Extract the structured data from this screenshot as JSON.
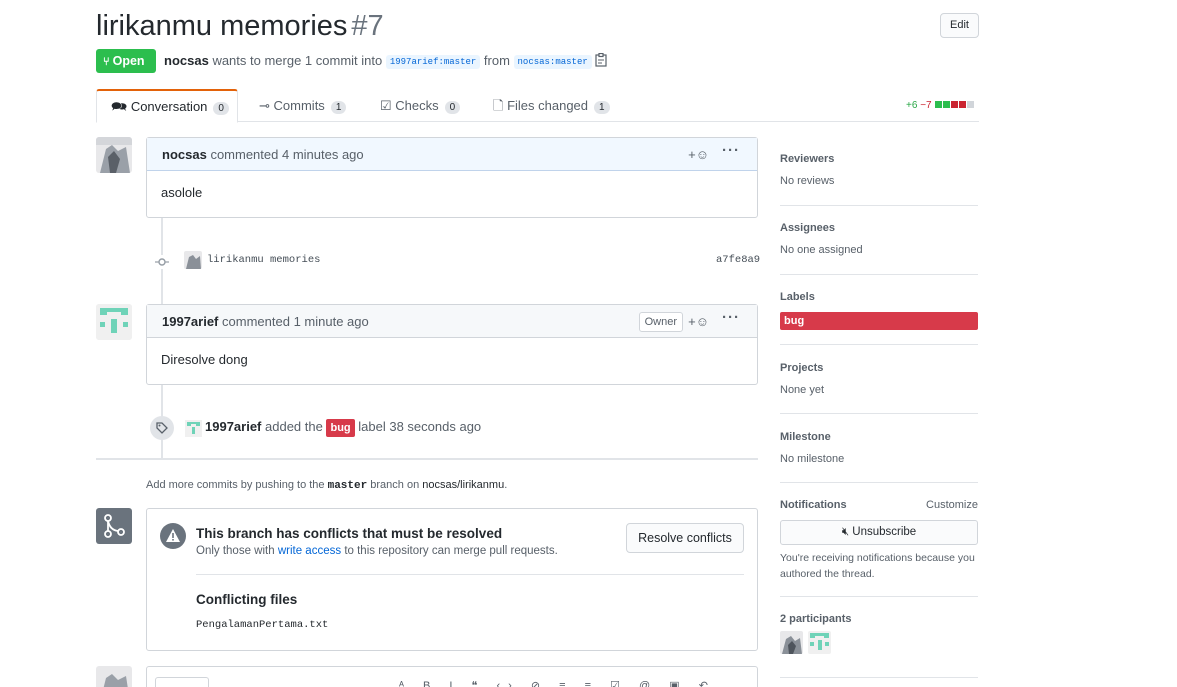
{
  "header": {
    "title": "lirikanmu memories",
    "number": "#7",
    "edit_label": "Edit",
    "state": "Open",
    "author": "nocsas",
    "merge_text": "wants to merge 1 commit into",
    "base_branch": "1997arief:master",
    "from_text": "from",
    "head_branch": "nocsas:master"
  },
  "tabs": [
    {
      "label": "Conversation",
      "count": "0"
    },
    {
      "label": "Commits",
      "count": "1"
    },
    {
      "label": "Checks",
      "count": "0"
    },
    {
      "label": "Files changed",
      "count": "1"
    }
  ],
  "diffstat": {
    "additions": "+6",
    "deletions": "−7"
  },
  "timeline": {
    "comment1": {
      "author": "nocsas",
      "action": "commented",
      "time": "4 minutes ago",
      "body": "asolole"
    },
    "commit": {
      "message": "lirikanmu memories",
      "sha": "a7fe8a9"
    },
    "comment2": {
      "author": "1997arief",
      "action": "commented",
      "time": "1 minute ago",
      "badge": "Owner",
      "body": "Diresolve dong"
    },
    "label_event": {
      "actor": "1997arief",
      "pre": "added the",
      "label": "bug",
      "post": "label 38 seconds ago"
    },
    "push_hint": {
      "pre": "Add more commits by pushing to the",
      "branch": "master",
      "mid": "branch on",
      "repo": "nocsas/lirikanmu",
      "end": "."
    },
    "conflict": {
      "title": "This branch has conflicts that must be resolved",
      "desc_pre": "Only those with",
      "desc_link": "write access",
      "desc_post": "to this repository can merge pull requests.",
      "button": "Resolve conflicts",
      "files_title": "Conflicting files",
      "file": "PengalamanPertama.txt"
    }
  },
  "sidebar": {
    "reviewers": {
      "title": "Reviewers",
      "value": "No reviews"
    },
    "assignees": {
      "title": "Assignees",
      "value": "No one assigned"
    },
    "labels": {
      "title": "Labels",
      "value": "bug"
    },
    "projects": {
      "title": "Projects",
      "value": "None yet"
    },
    "milestone": {
      "title": "Milestone",
      "value": "No milestone"
    },
    "notifications": {
      "title": "Notifications",
      "customize": "Customize",
      "button": "Unsubscribe",
      "note": "You're receiving notifications because you authored the thread."
    },
    "participants": {
      "title": "2 participants"
    }
  },
  "colors": {
    "open": "#2cbe4e",
    "bug": "#d73a4a",
    "accent_tab": "#e36209",
    "link": "#0366d6"
  }
}
